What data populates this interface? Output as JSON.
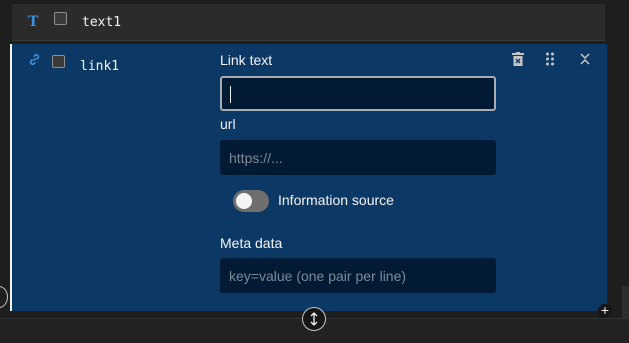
{
  "rows": [
    {
      "icon": "text-type-icon",
      "name": "text1"
    },
    {
      "icon": "link-icon",
      "name": "link1"
    }
  ],
  "editor": {
    "link_text_label": "Link text",
    "link_text_value": "",
    "url_label": "url",
    "url_placeholder": "https://...",
    "toggle_label": "Information source",
    "toggle_on": false,
    "meta_label": "Meta data",
    "meta_placeholder": "key=value (one pair per line)"
  },
  "icons": {
    "text_type": "T",
    "link": "🔗",
    "delete": "🗑",
    "drag": "⠿",
    "collapse": "⌃",
    "resize": "⇕",
    "add": "+"
  },
  "colors": {
    "panel_bg": "#0c3866",
    "input_bg": "#021a33",
    "accent": "#3a8fdb"
  }
}
